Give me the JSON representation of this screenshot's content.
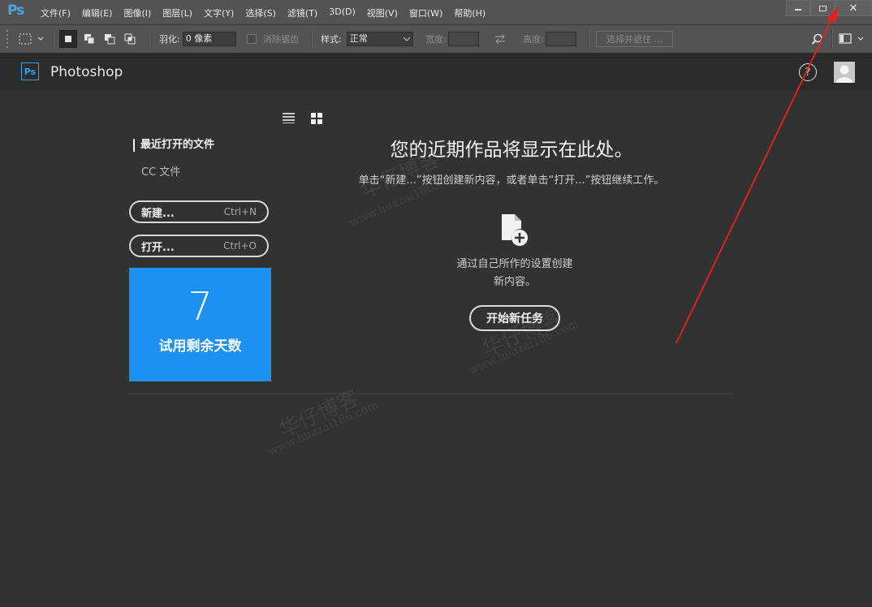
{
  "app": {
    "logo": "Ps",
    "menu": [
      "文件(F)",
      "编辑(E)",
      "图像(I)",
      "图层(L)",
      "文字(Y)",
      "选择(S)",
      "滤镜(T)",
      "3D(D)",
      "视图(V)",
      "窗口(W)",
      "帮助(H)"
    ],
    "window_controls": {
      "minimize": "minimize-icon",
      "maximize": "maximize-icon",
      "close": "✕"
    }
  },
  "options_bar": {
    "feather_label": "羽化:",
    "feather_value": "0 像素",
    "antialias_label": "消除锯齿",
    "style_label": "样式:",
    "style_value": "正常",
    "width_label": "宽度:",
    "height_label": "高度:",
    "select_mask_button": "选择并遮住 ..."
  },
  "home": {
    "badge": "Ps",
    "app_name": "Photoshop",
    "help": "?",
    "recent_files": "最近打开的文件",
    "cc_files": "CC 文件",
    "new_button": {
      "label": "新建...",
      "shortcut": "Ctrl+N"
    },
    "open_button": {
      "label": "打开...",
      "shortcut": "Ctrl+O"
    },
    "trial": {
      "days": "7",
      "label": "试用剩余天数"
    },
    "hero_title": "您的近期作品将显示在此处。",
    "hero_subtitle": "单击“新建...”按钮创建新内容，或者单击“打开...”按钮继续工作。",
    "create_desc_line1": "通过自己所作的设置创建",
    "create_desc_line2": "新内容。",
    "start_button": "开始新任务"
  },
  "watermarks": {
    "cn": "华仔博客",
    "url": "www.huazai186.com"
  },
  "colors": {
    "accent": "#1d91f2",
    "annotation_arrow": "#e0201e"
  }
}
